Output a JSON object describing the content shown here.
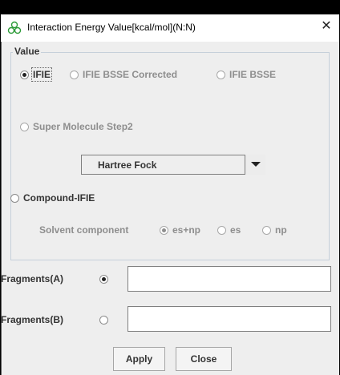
{
  "window": {
    "title": "Interaction Energy Value[kcal/mol](N:N)",
    "close_glyph": "✕",
    "icon": "molecule-icon"
  },
  "value_group": {
    "legend": "Value",
    "options": {
      "ifie": {
        "label": "IFIE",
        "selected": true,
        "enabled": true
      },
      "ifie_bsse_corrected": {
        "label": "IFIE BSSE Corrected",
        "selected": false,
        "enabled": false
      },
      "ifie_bsse": {
        "label": "IFIE BSSE",
        "selected": false,
        "enabled": false
      },
      "super_molecule_step2": {
        "label": "Super Molecule Step2",
        "selected": false,
        "enabled": false
      },
      "compound_ifie": {
        "label": "Compound-IFIE",
        "selected": false,
        "enabled": true
      }
    },
    "method_select": {
      "value": "Hartree Fock"
    },
    "solvent": {
      "label": "Solvent component",
      "options": [
        {
          "label": "es+np",
          "selected": true
        },
        {
          "label": "es",
          "selected": false
        },
        {
          "label": "np",
          "selected": false
        }
      ]
    }
  },
  "fragments": {
    "a": {
      "label": "Fragments(A)",
      "selected": true,
      "value": ""
    },
    "b": {
      "label": "Fragments(B)",
      "selected": false,
      "value": ""
    }
  },
  "buttons": {
    "apply": "Apply",
    "close": "Close"
  }
}
